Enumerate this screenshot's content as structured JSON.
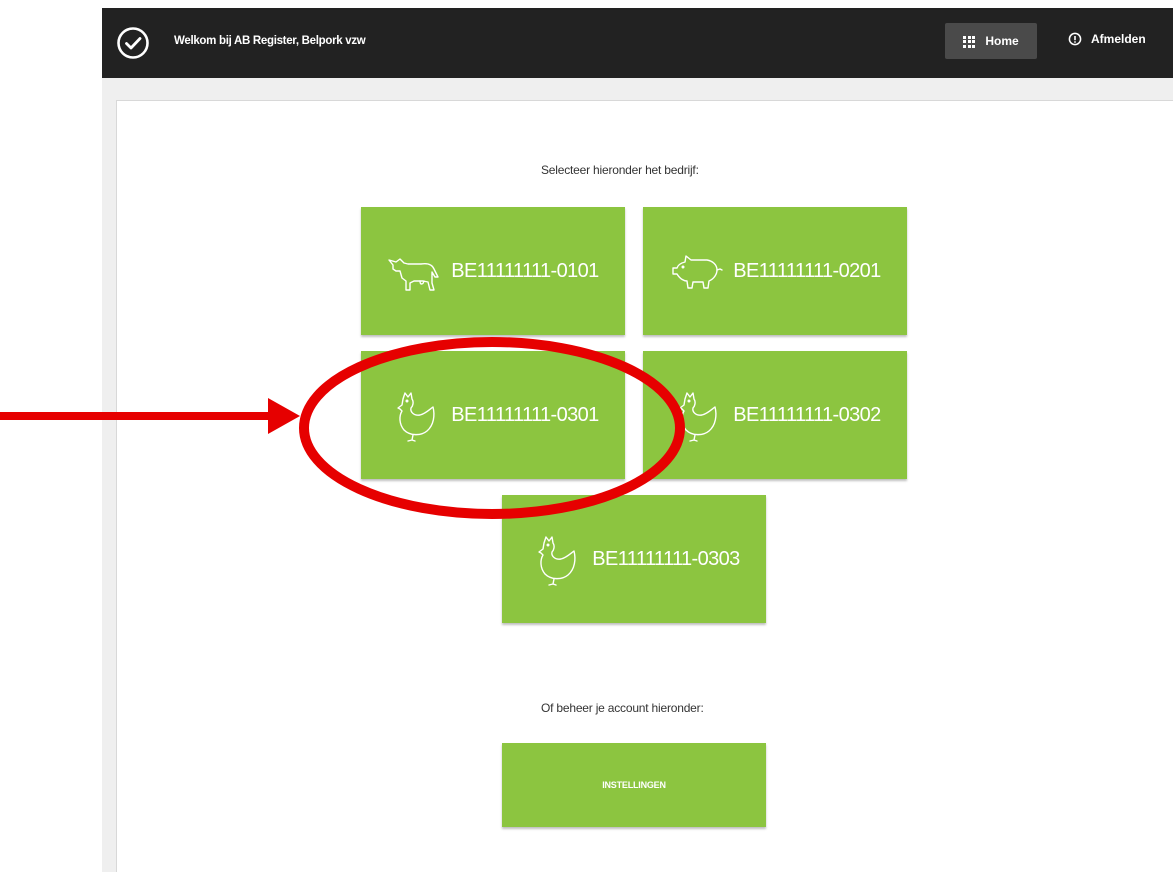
{
  "header": {
    "welcome_text": "Welkom bij AB Register, Belpork vzw",
    "home_label": "Home",
    "logout_label": "Afmelden"
  },
  "main": {
    "select_prompt": "Selecteer hieronder het bedrijf:",
    "companies": [
      {
        "id": "BE11111111-0101",
        "icon": "cow-icon"
      },
      {
        "id": "BE11111111-0201",
        "icon": "pig-icon"
      },
      {
        "id": "BE11111111-0301",
        "icon": "chicken-icon"
      },
      {
        "id": "BE11111111-0302",
        "icon": "chicken-icon"
      },
      {
        "id": "BE11111111-0303",
        "icon": "chicken-icon"
      }
    ],
    "account_prompt": "Of beheer je account hieronder:",
    "settings_label": "INSTELLINGEN"
  },
  "colors": {
    "topbar": "#222222",
    "tile_green": "#8cc540",
    "annotation_red": "#e60000"
  }
}
